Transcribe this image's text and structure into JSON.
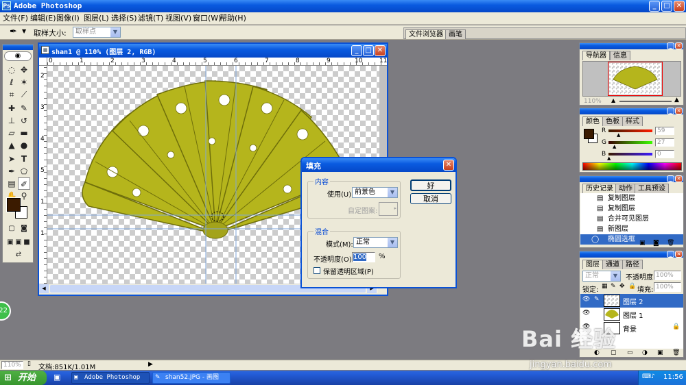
{
  "app_title": "Adobe Photoshop",
  "menu": [
    "文件(F)",
    "编辑(E)",
    "图像(I)",
    "图层(L)",
    "选择(S)",
    "滤镜(T)",
    "视图(V)",
    "窗口(W)",
    "帮助(H)"
  ],
  "options_bar": {
    "sample_size_label": "取样大小:",
    "sample_size_value": "取样点",
    "palette_well_tabs": [
      "文件浏览器",
      "画笔"
    ]
  },
  "document": {
    "title": "shan1 @ 110% (图层 2, RGB)",
    "ruler_numbers": [
      "0",
      "1",
      "2",
      "3",
      "4",
      "5",
      "6",
      "7",
      "8",
      "9",
      "10",
      "11"
    ],
    "vruler_numbers": [
      "2",
      "3",
      "4",
      "5",
      "6",
      "7",
      "8",
      "9",
      "1",
      "1"
    ]
  },
  "fill_dialog": {
    "title": "填充",
    "content_group": "内容",
    "use_label": "使用(U):",
    "use_value": "前景色",
    "custom_pattern_label": "自定图案:",
    "blend_group": "混合",
    "mode_label": "模式(M):",
    "mode_value": "正常",
    "opacity_label": "不透明度(O):",
    "opacity_value": "100",
    "opacity_unit": "%",
    "preserve_label": "保留透明区域(P)",
    "ok_label": "好",
    "cancel_label": "取消"
  },
  "navigator": {
    "tabs": [
      "导航器",
      "信息"
    ],
    "zoom": "110%"
  },
  "color_panel": {
    "tabs": [
      "颜色",
      "色板",
      "样式"
    ],
    "channels": [
      {
        "label": "R",
        "value": "59",
        "color": "#c80000"
      },
      {
        "label": "G",
        "value": "27",
        "color": "#00a000"
      },
      {
        "label": "B",
        "value": "0",
        "color": "#0000c8"
      }
    ]
  },
  "history_panel": {
    "tabs": [
      "历史记录",
      "动作",
      "工具预设"
    ],
    "items": [
      "复制图层",
      "复制图层",
      "合并可见图层",
      "新图层",
      "椭圆选框"
    ]
  },
  "layers_panel": {
    "tabs": [
      "图层",
      "通道",
      "路径"
    ],
    "blend_mode": "正常",
    "opacity_label": "不透明度:",
    "opacity_value": "100%",
    "lock_label": "锁定:",
    "fill_label": "填充:",
    "fill_value": "100%",
    "layers": [
      {
        "name": "图层 2",
        "selected": true
      },
      {
        "name": "图层 1",
        "selected": false
      },
      {
        "name": "背景",
        "selected": false
      }
    ]
  },
  "status_bar": {
    "zoom": "110%",
    "doc_size": "文档:851K/1.01M"
  },
  "taskbar": {
    "start_label": "开始",
    "tasks": [
      "Adobe Photoshop",
      "shan52.JPG - 画图"
    ],
    "clock": "11:56"
  },
  "watermark": {
    "brand": "Bai 经验",
    "url": "jingyan.baidu.com"
  },
  "side_badge": "22",
  "colors": {
    "foreground": "#3b1b00",
    "fan": "#b5b51c",
    "xp_blue": "#0a5be0"
  }
}
